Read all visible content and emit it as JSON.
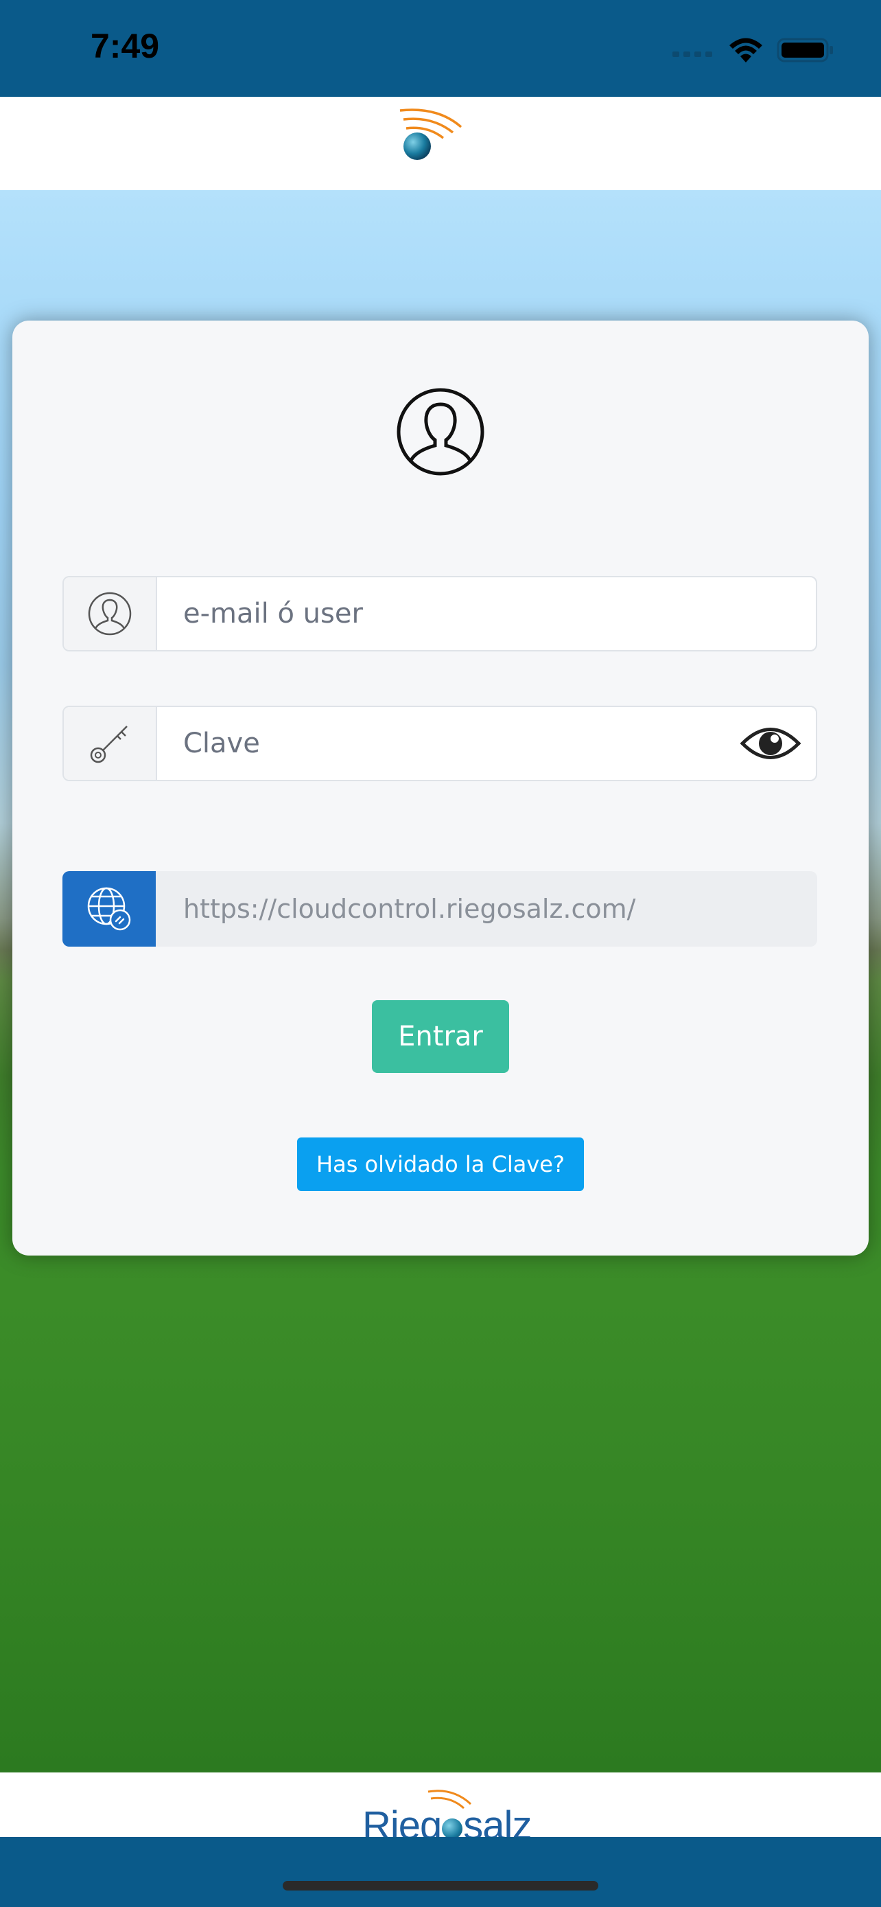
{
  "status_bar": {
    "time": "7:49",
    "icons": [
      "signal-icon",
      "wifi-icon",
      "battery-icon"
    ]
  },
  "header": {
    "logo_icon": "globe-wifi-logo"
  },
  "login_card": {
    "avatar_icon": "user-circle-icon",
    "user_field": {
      "placeholder": "e-mail ó user",
      "value": "",
      "icon": "user-icon"
    },
    "password_field": {
      "placeholder": "Clave",
      "value": "",
      "icon": "key-icon",
      "toggle_icon": "eye-icon"
    },
    "server_field": {
      "value": "https://cloudcontrol.riegosalz.com/",
      "icon": "globe-link-icon"
    },
    "enter_button": "Entrar",
    "forgot_button": "Has olvidado la Clave?"
  },
  "footer": {
    "brand_left": "Rieg",
    "brand_right": "salz"
  },
  "colors": {
    "bar": "#0a5a8a",
    "enter": "#3bbfa0",
    "forgot": "#0aa0f0",
    "server_addon": "#1f6fc5"
  }
}
